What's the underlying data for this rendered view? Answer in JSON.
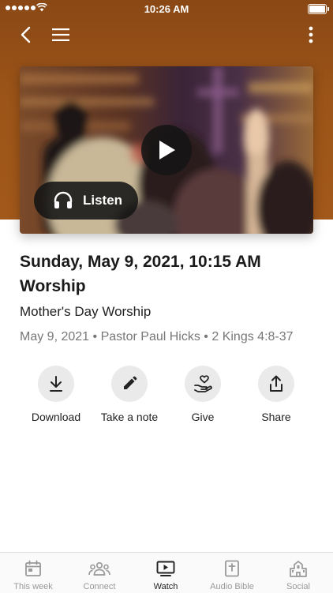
{
  "status_bar": {
    "time": "10:26 AM"
  },
  "video": {
    "listen_label": "Listen"
  },
  "sermon": {
    "title": "Sunday, May 9, 2021, 10:15 AM Worship",
    "subtitle": "Mother's Day Worship",
    "date": "May 9, 2021",
    "separator": "•",
    "speaker": "Pastor Paul Hicks",
    "scripture": "2 Kings 4:8-37"
  },
  "actions": [
    {
      "label": "Download",
      "icon": "download-icon"
    },
    {
      "label": "Take a note",
      "icon": "pencil-icon"
    },
    {
      "label": "Give",
      "icon": "give-heart-hand-icon"
    },
    {
      "label": "Share",
      "icon": "share-icon"
    }
  ],
  "tabs": [
    {
      "label": "This week",
      "icon": "calendar-icon",
      "active": false
    },
    {
      "label": "Connect",
      "icon": "people-icon",
      "active": false
    },
    {
      "label": "Watch",
      "icon": "play-screen-icon",
      "active": true
    },
    {
      "label": "Audio Bible",
      "icon": "bible-icon",
      "active": false
    },
    {
      "label": "Social",
      "icon": "church-building-icon",
      "active": false
    }
  ],
  "colors": {
    "header_brown": "#9c5418",
    "accent_dark": "#141414",
    "muted_text": "#777777"
  }
}
